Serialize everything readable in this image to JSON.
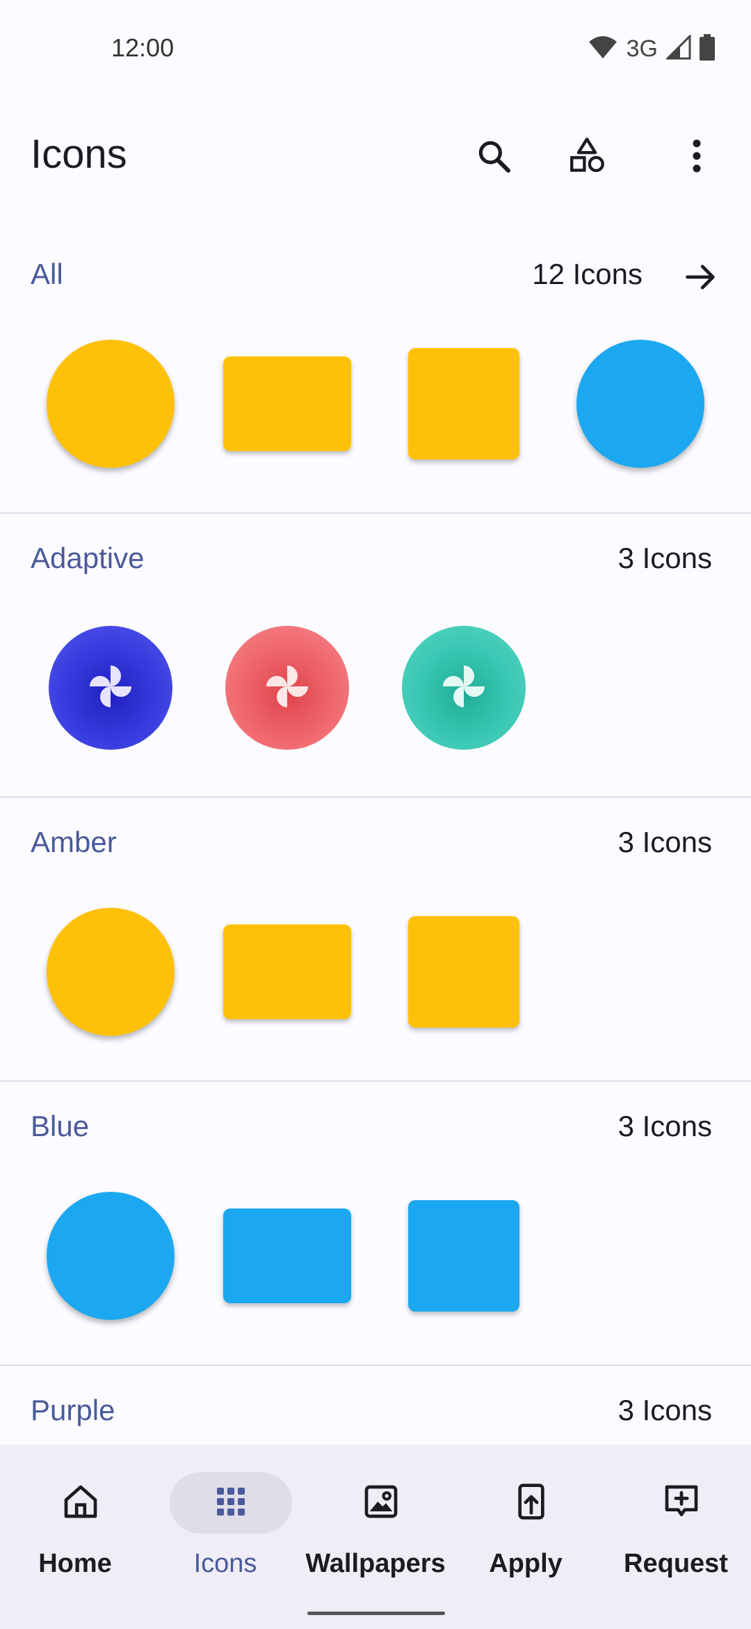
{
  "status_bar": {
    "time": "12:00",
    "network": "3G"
  },
  "app_bar": {
    "title": "Icons",
    "actions": [
      "search-icon",
      "shapes-icon",
      "more-vert-icon"
    ]
  },
  "colors": {
    "accent": "#4a5a9a",
    "amber": "#FFC107",
    "blue": "#1BA8F0",
    "background": "#fcfbff",
    "nav_background": "#efedf6"
  },
  "sections": [
    {
      "title": "All",
      "count": "12 Icons",
      "has_arrow": true,
      "icons": [
        {
          "shape": "circle",
          "color": "#FFC107"
        },
        {
          "shape": "rect",
          "color": "#FFC107"
        },
        {
          "shape": "square",
          "color": "#FFC107"
        },
        {
          "shape": "circle",
          "color": "#1BA8F0"
        }
      ]
    },
    {
      "title": "Adaptive",
      "count": "3 Icons",
      "has_arrow": false,
      "icons": [
        {
          "shape": "adaptive",
          "color": "#2E2FD8",
          "icon": "pinwheel-icon"
        },
        {
          "shape": "adaptive",
          "color": "#F06A70",
          "icon": "pinwheel-icon"
        },
        {
          "shape": "adaptive",
          "color": "#3CC9B5",
          "icon": "pinwheel-icon"
        }
      ]
    },
    {
      "title": "Amber",
      "count": "3 Icons",
      "has_arrow": false,
      "icons": [
        {
          "shape": "circle",
          "color": "#FFC107"
        },
        {
          "shape": "rect",
          "color": "#FFC107"
        },
        {
          "shape": "square",
          "color": "#FFC107"
        }
      ]
    },
    {
      "title": "Blue",
      "count": "3 Icons",
      "has_arrow": false,
      "icons": [
        {
          "shape": "circle",
          "color": "#1BA8F0"
        },
        {
          "shape": "rect",
          "color": "#1BA8F0"
        },
        {
          "shape": "square",
          "color": "#1BA8F0"
        }
      ]
    },
    {
      "title": "Purple",
      "count": "3 Icons",
      "has_arrow": false,
      "icons": []
    }
  ],
  "bottom_nav": [
    {
      "label": "Home",
      "icon": "home-icon",
      "active": false
    },
    {
      "label": "Icons",
      "icon": "apps-grid-icon",
      "active": true
    },
    {
      "label": "Wallpapers",
      "icon": "wallpaper-icon",
      "active": false
    },
    {
      "label": "Apply",
      "icon": "apply-icon",
      "active": false
    },
    {
      "label": "Request",
      "icon": "request-icon",
      "active": false
    }
  ]
}
